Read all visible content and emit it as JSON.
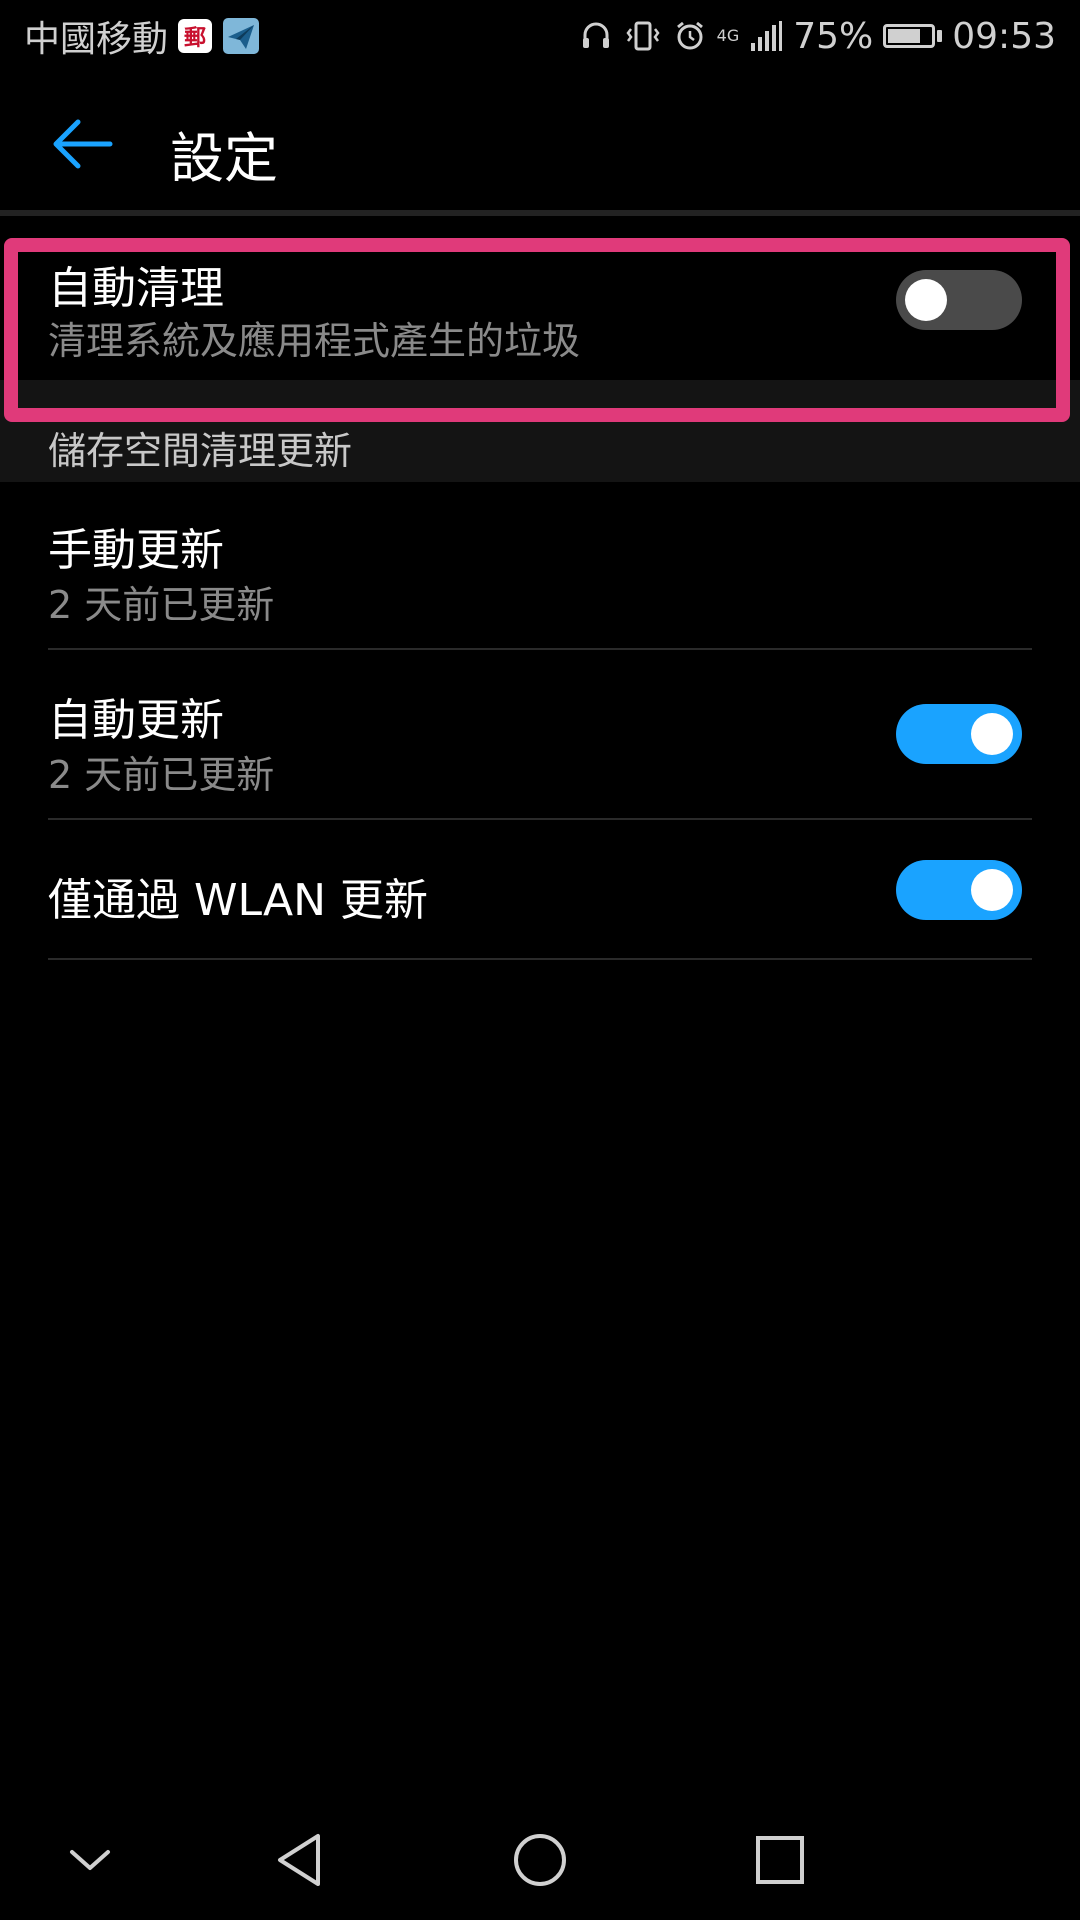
{
  "status_bar": {
    "carrier": "中國移動",
    "mail_badge": "郵",
    "network": "4G",
    "battery": "75%",
    "battery_level": 0.75,
    "time": "09:53"
  },
  "header": {
    "title": "設定",
    "back_icon": "back-arrow-icon"
  },
  "settings": [
    {
      "title": "自動清理",
      "subtitle": "清理系統及應用程式產生的垃圾",
      "toggle": false
    }
  ],
  "section": {
    "label": "儲存空間清理更新",
    "items": [
      {
        "title": "手動更新",
        "subtitle": "2 天前已更新",
        "toggle": null
      },
      {
        "title": "自動更新",
        "subtitle": "2 天前已更新",
        "toggle": true
      },
      {
        "title": "僅通過 WLAN 更新",
        "subtitle": "",
        "toggle": true
      }
    ]
  },
  "colors": {
    "accent": "#1aa3ff",
    "highlight": "#e03a7a",
    "toggle_off": "#4a4a4a"
  },
  "nav_bar": {
    "icons": [
      "chevron-down-icon",
      "back-triangle-icon",
      "home-circle-icon",
      "recent-square-icon"
    ]
  }
}
